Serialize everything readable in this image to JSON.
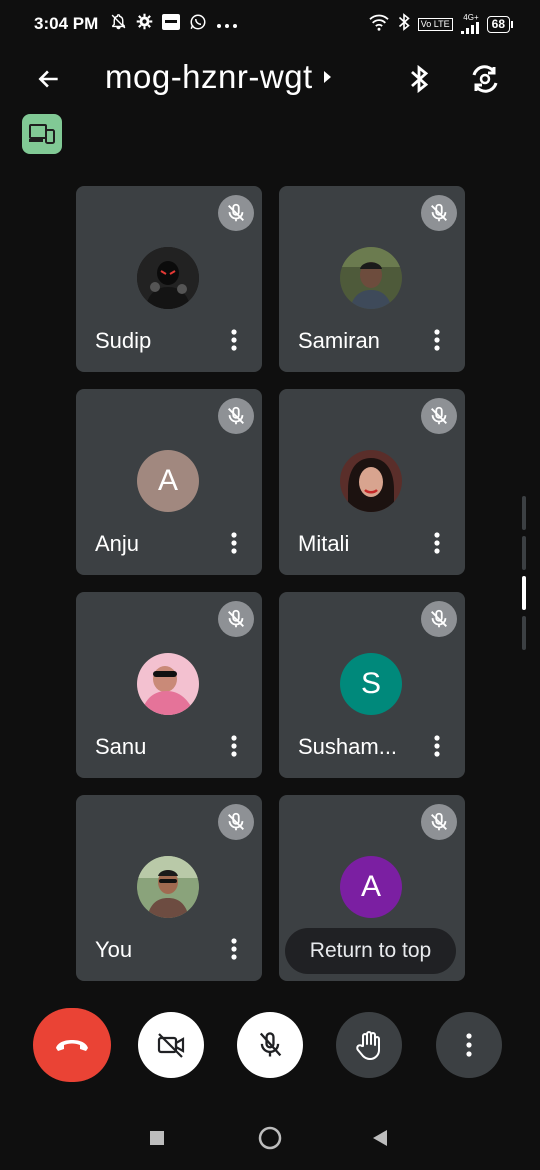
{
  "status_bar": {
    "time": "3:04 PM",
    "volte": "Vo LTE",
    "network": "4G+",
    "battery": "68"
  },
  "header": {
    "meeting_code": "mog-hznr-wgt"
  },
  "participants": [
    {
      "name": "Sudip",
      "avatar_type": "photo",
      "muted": true
    },
    {
      "name": "Samiran",
      "avatar_type": "photo",
      "muted": true
    },
    {
      "name": "Anju",
      "avatar_type": "letter",
      "initial": "A",
      "avatar_color": "#a1887f",
      "muted": true
    },
    {
      "name": "Mitali",
      "avatar_type": "photo",
      "muted": true
    },
    {
      "name": "Sanu",
      "avatar_type": "photo",
      "muted": true
    },
    {
      "name": "Susham...",
      "avatar_type": "letter",
      "initial": "S",
      "avatar_color": "#00897b",
      "muted": true
    },
    {
      "name": "You",
      "avatar_type": "photo",
      "muted": true
    },
    {
      "name": "",
      "avatar_type": "letter",
      "initial": "A",
      "avatar_color": "#7b1fa2",
      "muted": true
    }
  ],
  "return_to_top": "Return to top",
  "controls": {
    "end_call_color": "#ea4335",
    "camera_off": true,
    "mic_off": true
  },
  "colors": {
    "background": "#0f0f0f",
    "tile": "#3c4043",
    "companion": "#81c995"
  }
}
